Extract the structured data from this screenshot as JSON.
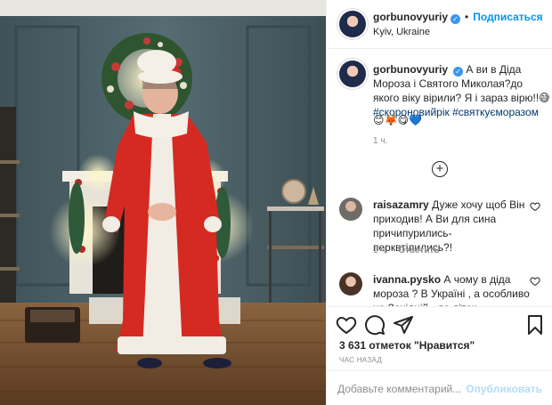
{
  "post": {
    "username": "gorbunovyuriy",
    "follow_label": "Подписаться",
    "location": "Kyiv, Ukraine",
    "caption": "А ви в Діда Мороза і Святого Миколая?до якого віку вірили? Я і зараз вірю!!😅",
    "hashtags": [
      "#скороновийрік",
      "#святкуєморазом"
    ],
    "caption_emojis": "😊🦊😋💙",
    "caption_time": "1 ч.",
    "more_symbol": "+"
  },
  "comments": [
    {
      "username": "raisazamry",
      "text": "Дуже хочу щоб Він приходив! А Ви для сина причипурились-перквтілились?!",
      "time": "1 ч.",
      "reply_label": "Ответить"
    },
    {
      "username": "ivanna.pysko",
      "text": "А чому в діда мороза ? В Україні , а особливо на Західній , до діток приходить",
      "time": "",
      "reply_label": ""
    }
  ],
  "actions": {
    "likes": "3 631 отметок \"Нравится\"",
    "ago": "час назад",
    "icons": [
      "heart-icon",
      "comment-icon",
      "share-icon",
      "bookmark-icon"
    ]
  },
  "add_comment": {
    "placeholder": "Добавьте комментарий...",
    "publish_label": "Опубликовать"
  },
  "colors": {
    "link": "#0095f6",
    "verified": "#3897f0",
    "muted": "#8e8e8e",
    "publish_disabled": "#b3dbff"
  }
}
